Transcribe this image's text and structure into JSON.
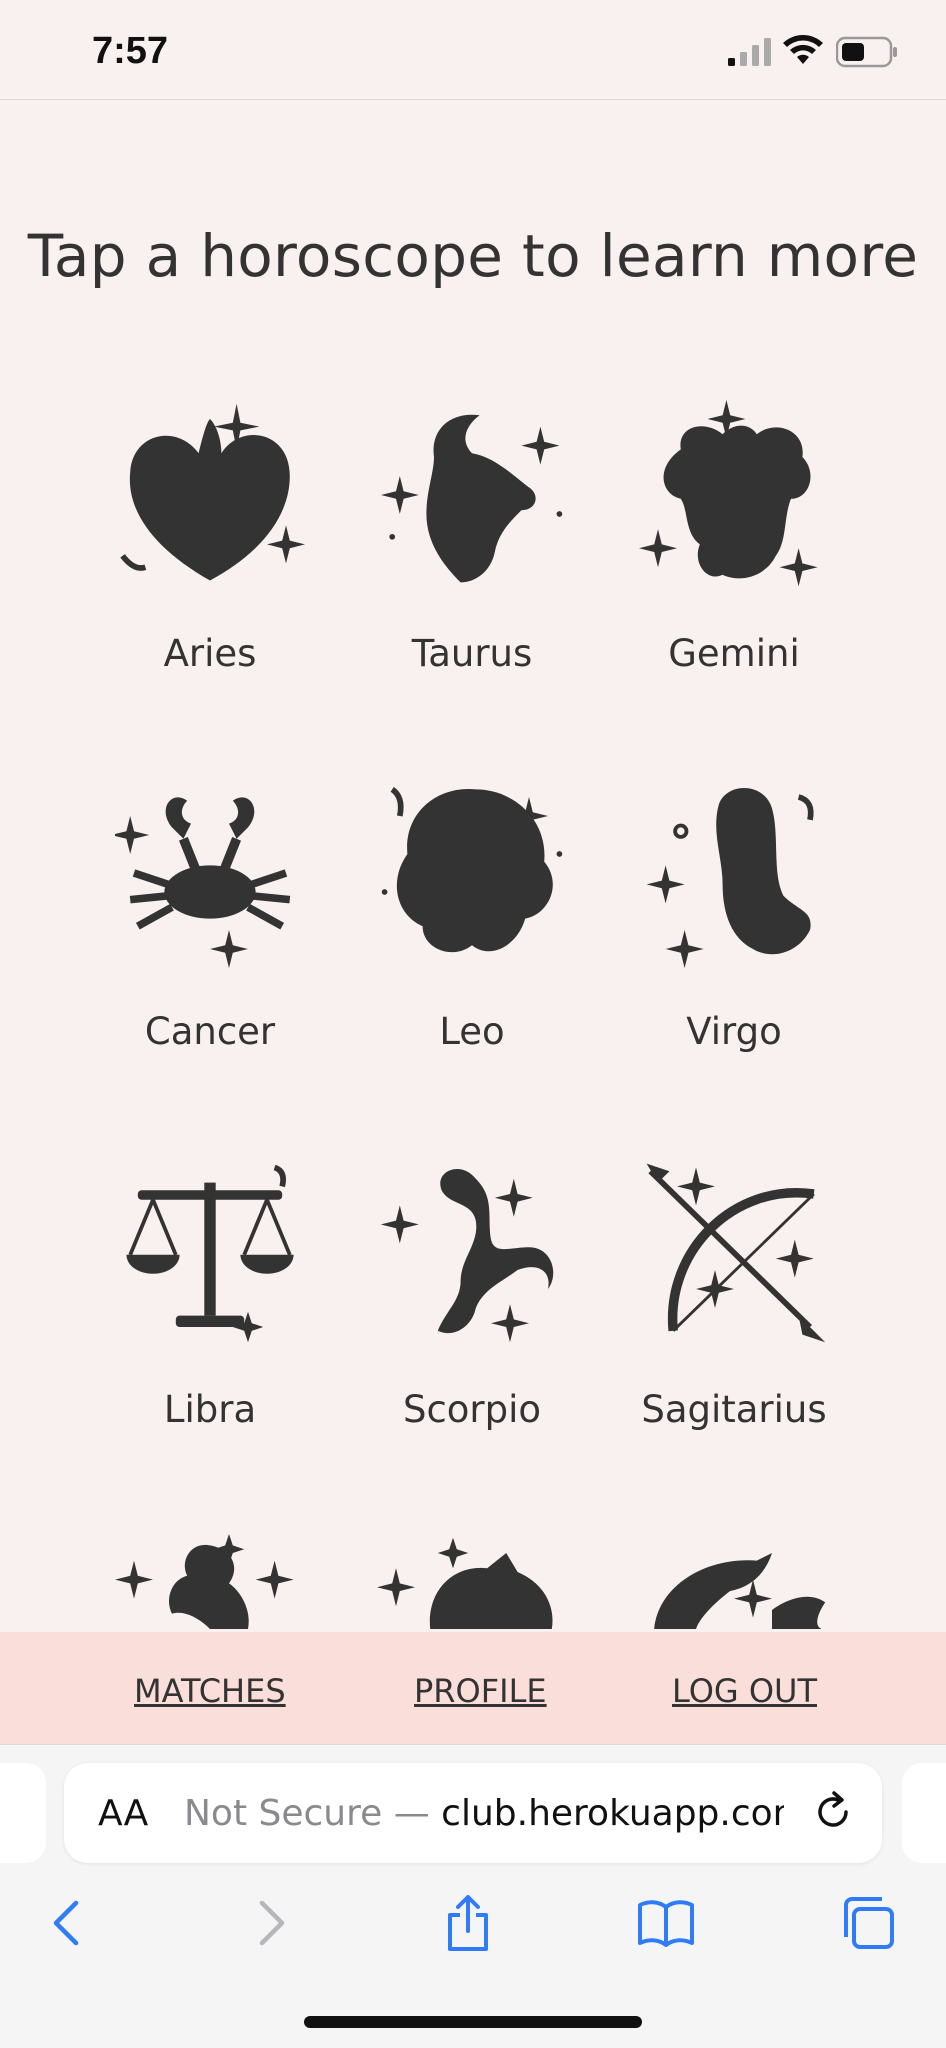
{
  "status_bar": {
    "time": "7:57"
  },
  "page": {
    "heading": "Tap a horoscope to learn more"
  },
  "signs": [
    {
      "label": "Aries",
      "icon": "aries-icon"
    },
    {
      "label": "Taurus",
      "icon": "taurus-icon"
    },
    {
      "label": "Gemini",
      "icon": "gemini-icon"
    },
    {
      "label": "Cancer",
      "icon": "cancer-icon"
    },
    {
      "label": "Leo",
      "icon": "leo-icon"
    },
    {
      "label": "Virgo",
      "icon": "virgo-icon"
    },
    {
      "label": "Libra",
      "icon": "libra-icon"
    },
    {
      "label": "Scorpio",
      "icon": "scorpio-icon"
    },
    {
      "label": "Sagitarius",
      "icon": "sagittarius-icon"
    },
    {
      "label": "",
      "icon": "capricorn-icon"
    },
    {
      "label": "",
      "icon": "aquarius-icon"
    },
    {
      "label": "",
      "icon": "pisces-icon"
    }
  ],
  "bottom_nav": {
    "matches": "MATCHES",
    "profile": "PROFILE",
    "logout": "LOG OUT"
  },
  "browser": {
    "aa_label": "AA",
    "url_prefix": "Not Secure — ",
    "url_domain": "club.herokuapp.com"
  },
  "colors": {
    "background": "#f8f1ef",
    "nav_bar": "#f9ded9",
    "icon": "#333333",
    "ios_blue": "#2f7cf6"
  }
}
